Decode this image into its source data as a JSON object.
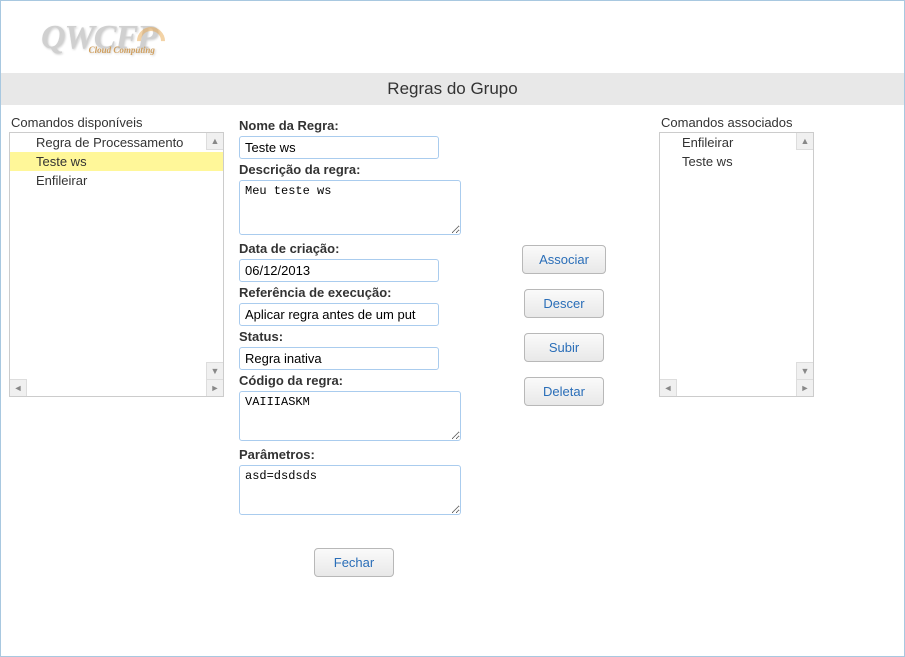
{
  "logo": {
    "text": "QWCFP",
    "sub": "Cloud Computing"
  },
  "header": "Regras do Grupo",
  "leftPanel": {
    "title": "Comandos disponíveis",
    "items": [
      "Regra de Processamento",
      "Teste ws",
      "Enfileirar"
    ],
    "selectedIndex": 1
  },
  "form": {
    "nome": {
      "label": "Nome da Regra:",
      "value": "Teste ws"
    },
    "descricao": {
      "label": "Descrição da regra:",
      "value": "Meu teste ws"
    },
    "data": {
      "label": "Data de criação:",
      "value": "06/12/2013"
    },
    "referencia": {
      "label": "Referência de execução:",
      "value": "Aplicar regra antes de um put"
    },
    "status": {
      "label": "Status:",
      "value": "Regra inativa"
    },
    "codigo": {
      "label": "Código da regra:",
      "value": "VAIIIASKM"
    },
    "parametros": {
      "label": "Parâmetros:",
      "value": "asd=dsdsds"
    }
  },
  "buttons": {
    "associar": "Associar",
    "descer": "Descer",
    "subir": "Subir",
    "deletar": "Deletar",
    "fechar": "Fechar"
  },
  "rightPanel": {
    "title": "Comandos associados",
    "items": [
      "Enfileirar",
      "Teste ws"
    ]
  }
}
